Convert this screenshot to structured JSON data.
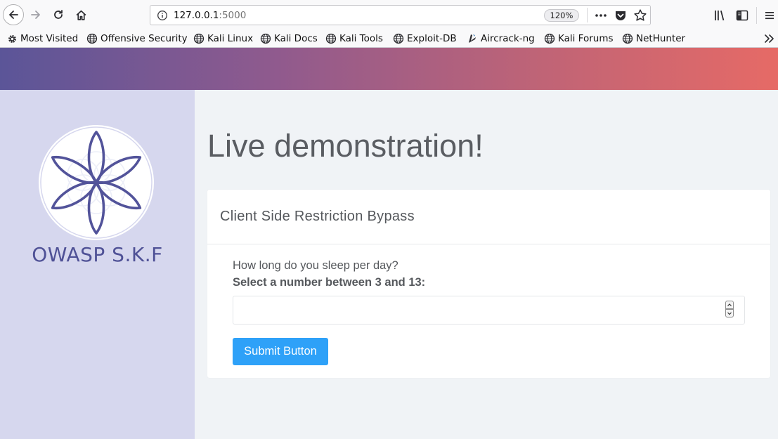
{
  "browser": {
    "url_host": "127.0.0.1",
    "url_port": ":5000",
    "zoom": "120%"
  },
  "bookmarks": [
    {
      "label": "Most Visited",
      "icon": "gear-icon"
    },
    {
      "label": "Offensive Security",
      "icon": "globe-icon"
    },
    {
      "label": "Kali Linux",
      "icon": "globe-icon"
    },
    {
      "label": "Kali Docs",
      "icon": "globe-icon"
    },
    {
      "label": "Kali Tools",
      "icon": "globe-icon"
    },
    {
      "label": "Exploit-DB",
      "icon": "globe-icon"
    },
    {
      "label": "Aircrack-ng",
      "icon": "aircrack-icon"
    },
    {
      "label": "Kali Forums",
      "icon": "globe-icon"
    },
    {
      "label": "NetHunter",
      "icon": "globe-icon"
    }
  ],
  "sidebar": {
    "brand": "OWASP S.K.F"
  },
  "main": {
    "title": "Live demonstration!",
    "card": {
      "title": "Client Side Restriction Bypass",
      "question": "How long do you sleep per day?",
      "instruction": "Select a number between 3 and 13:",
      "input_value": "",
      "submit_label": "Submit Button"
    }
  },
  "colors": {
    "banner_start": "#5b5598",
    "banner_end": "#e66a66",
    "sidebar_bg": "#d6d7ee",
    "brand": "#4f5196",
    "button": "#2ea1f8"
  }
}
